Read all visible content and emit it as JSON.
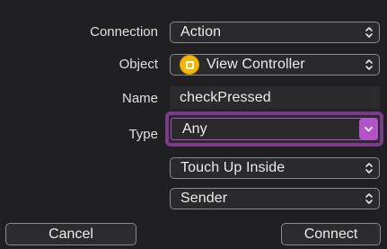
{
  "dialog": {
    "connection": {
      "label": "Connection",
      "value": "Action"
    },
    "object": {
      "label": "Object",
      "value": "View Controller",
      "icon": "view-controller-icon"
    },
    "name": {
      "label": "Name",
      "value": "checkPressed"
    },
    "type": {
      "label": "Type",
      "value": "Any",
      "accent": "#b253c8"
    },
    "event": {
      "value": "Touch Up Inside"
    },
    "arguments": {
      "value": "Sender"
    },
    "cancel_label": "Cancel",
    "connect_label": "Connect"
  }
}
